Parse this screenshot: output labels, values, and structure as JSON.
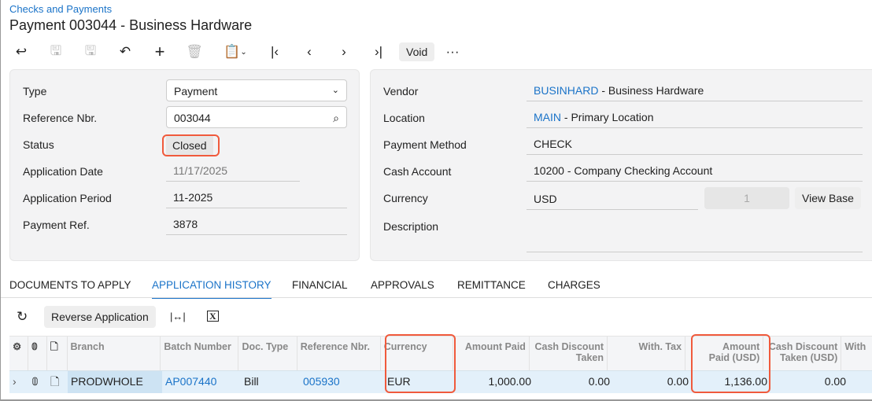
{
  "breadcrumb": "Checks and Payments",
  "title": "Payment 003044 - Business Hardware",
  "toolbar": {
    "void": "Void",
    "more": "···"
  },
  "left": {
    "type_label": "Type",
    "type_value": "Payment",
    "ref_label": "Reference Nbr.",
    "ref_value": "003044",
    "status_label": "Status",
    "status_value": "Closed",
    "appdate_label": "Application Date",
    "appdate_value": "11/17/2025",
    "period_label": "Application Period",
    "period_value": "11-2025",
    "payref_label": "Payment Ref.",
    "payref_value": "3878"
  },
  "right": {
    "vendor_label": "Vendor",
    "vendor_code": "BUSINHARD",
    "vendor_name": " - Business Hardware",
    "location_label": "Location",
    "location_code": "MAIN",
    "location_name": " - Primary Location",
    "method_label": "Payment Method",
    "method_value": "CHECK",
    "cash_label": "Cash Account",
    "cash_value": "10200 - Company Checking Account",
    "currency_label": "Currency",
    "currency_value": "USD",
    "rate_value": "1",
    "view_base": "View Base",
    "desc_label": "Description"
  },
  "tabs": [
    "DOCUMENTS TO APPLY",
    "APPLICATION HISTORY",
    "FINANCIAL",
    "APPROVALS",
    "REMITTANCE",
    "CHARGES"
  ],
  "grid_toolbar": {
    "reverse": "Reverse Application"
  },
  "columns": [
    "Branch",
    "Batch Number",
    "Doc. Type",
    "Reference Nbr.",
    "Currency",
    "Amount Paid",
    "Cash Discount Taken",
    "With. Tax",
    "Amount Paid (USD)",
    "Cash Discount Taken (USD)",
    "With"
  ],
  "row": {
    "branch": "PRODWHOLE",
    "batch": "AP007440",
    "doctype": "Bill",
    "refnbr": "005930",
    "currency": "EUR",
    "amount_paid": "1,000.00",
    "cash_disc": "0.00",
    "with_tax": "0.00",
    "amount_paid_usd": "1,136.00",
    "cash_disc_usd": "0.00"
  }
}
